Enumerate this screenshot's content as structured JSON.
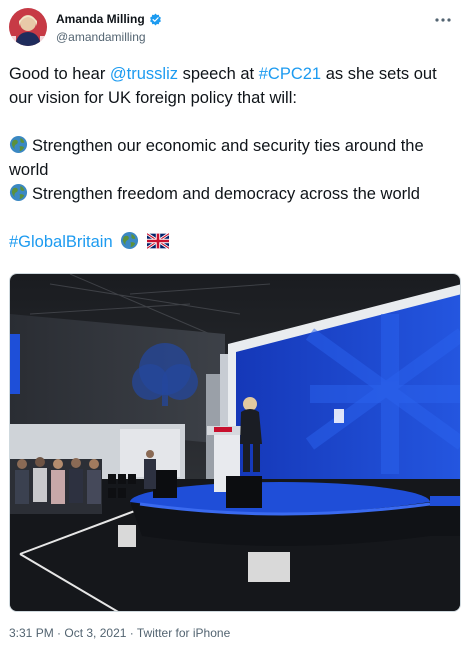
{
  "user": {
    "name": "Amanda Milling",
    "handle": "@amandamilling"
  },
  "tweet": {
    "line1_pre": "Good to hear ",
    "mention": "@trussliz",
    "line1_mid": " speech at ",
    "hashtag_event": "#CPC21",
    "line1_post": " as she sets out our vision for UK foreign policy that will:",
    "bullet1": "Strengthen our economic and security ties around the world",
    "bullet2": "Strengthen freedom and democracy across the world",
    "hashtag_closing": "#GlobalBritain"
  },
  "meta": {
    "time": "3:31 PM",
    "separator1": " · ",
    "date": "Oct 3, 2021",
    "separator2": " · ",
    "source": "Twitter for iPhone"
  },
  "icons": {
    "more": "more-icon",
    "verified": "verified-badge-icon",
    "globe": "globe-icon",
    "flag": "uk-flag-icon"
  },
  "colors": {
    "link": "#1d9bf0",
    "text": "#0f1419",
    "secondary": "#536471",
    "stage_blue": "#1e4fd8"
  }
}
